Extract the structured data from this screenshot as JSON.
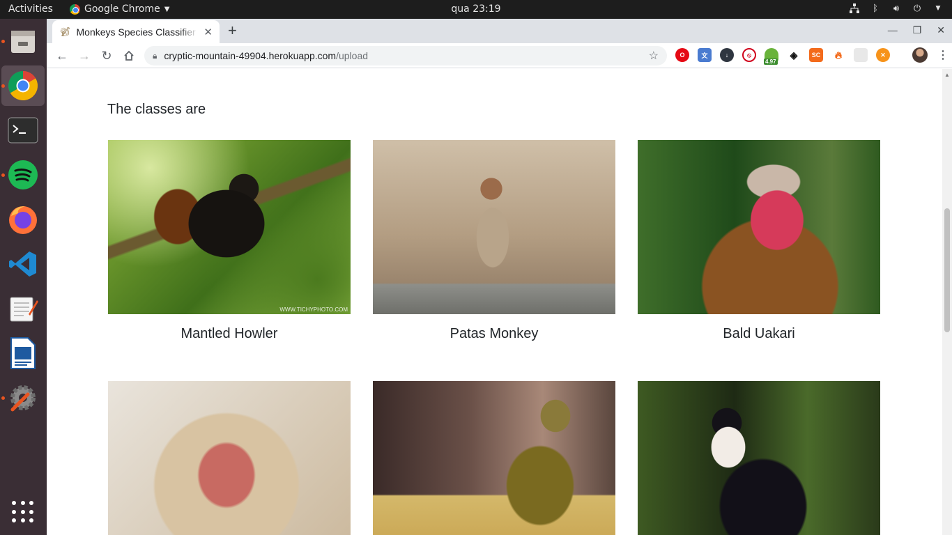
{
  "topbar": {
    "activities": "Activities",
    "app_name": "Google Chrome",
    "clock": "qua 23:19"
  },
  "dock": {
    "items": [
      "files",
      "google-chrome",
      "terminal",
      "spotify",
      "firefox",
      "vscode",
      "text-editor",
      "libreoffice-writer",
      "settings"
    ]
  },
  "browser": {
    "tab_title": "Monkeys Species Classifier",
    "url_host": "cryptic-mountain-49904.herokuapp.com",
    "url_path": "/upload",
    "extension_badge": "4.97",
    "ext_sc": "SC"
  },
  "page": {
    "heading": "The classes are",
    "cards": [
      {
        "label": "Mantled Howler",
        "watermark": "WWW.TICHYPHOTO.COM"
      },
      {
        "label": "Patas Monkey"
      },
      {
        "label": "Bald Uakari"
      },
      {
        "label": ""
      },
      {
        "label": ""
      },
      {
        "label": ""
      }
    ]
  }
}
